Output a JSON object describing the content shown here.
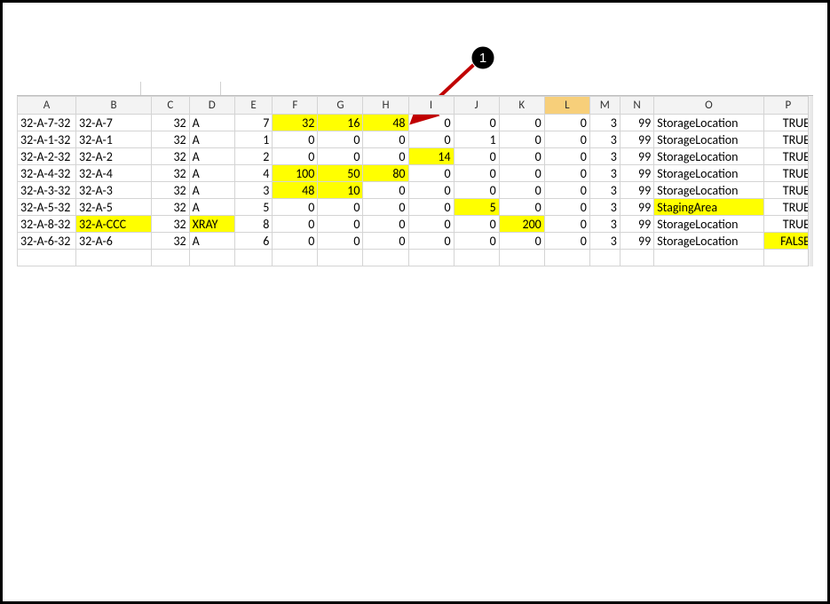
{
  "callout": {
    "number": "1"
  },
  "columns": [
    {
      "label": "A",
      "sel": false
    },
    {
      "label": "B",
      "sel": false
    },
    {
      "label": "C",
      "sel": false
    },
    {
      "label": "D",
      "sel": false
    },
    {
      "label": "E",
      "sel": false
    },
    {
      "label": "F",
      "sel": false
    },
    {
      "label": "G",
      "sel": false
    },
    {
      "label": "H",
      "sel": false
    },
    {
      "label": "I",
      "sel": false
    },
    {
      "label": "J",
      "sel": false
    },
    {
      "label": "K",
      "sel": false
    },
    {
      "label": "L",
      "sel": true
    },
    {
      "label": "M",
      "sel": false
    },
    {
      "label": "N",
      "sel": false
    },
    {
      "label": "O",
      "sel": false
    },
    {
      "label": "P",
      "sel": false
    }
  ],
  "col_align": [
    "txt",
    "txt",
    "num",
    "txt",
    "num",
    "num",
    "num",
    "num",
    "num",
    "num",
    "num",
    "num",
    "num",
    "num",
    "txt",
    "num"
  ],
  "rows": [
    {
      "cells": [
        {
          "v": "32-A-7-32"
        },
        {
          "v": "32-A-7"
        },
        {
          "v": "32"
        },
        {
          "v": "A"
        },
        {
          "v": "7"
        },
        {
          "v": "32",
          "hl": true
        },
        {
          "v": "16",
          "hl": true
        },
        {
          "v": "48",
          "hl": true
        },
        {
          "v": "0"
        },
        {
          "v": "0"
        },
        {
          "v": "0"
        },
        {
          "v": "0"
        },
        {
          "v": "3"
        },
        {
          "v": "99"
        },
        {
          "v": "StorageLocation"
        },
        {
          "v": "TRUE"
        }
      ]
    },
    {
      "cells": [
        {
          "v": "32-A-1-32"
        },
        {
          "v": "32-A-1"
        },
        {
          "v": "32"
        },
        {
          "v": "A"
        },
        {
          "v": "1"
        },
        {
          "v": "0"
        },
        {
          "v": "0"
        },
        {
          "v": "0"
        },
        {
          "v": "0"
        },
        {
          "v": "1"
        },
        {
          "v": "0"
        },
        {
          "v": "0"
        },
        {
          "v": "3"
        },
        {
          "v": "99"
        },
        {
          "v": "StorageLocation"
        },
        {
          "v": "TRUE"
        }
      ]
    },
    {
      "cells": [
        {
          "v": "32-A-2-32"
        },
        {
          "v": "32-A-2"
        },
        {
          "v": "32"
        },
        {
          "v": "A"
        },
        {
          "v": "2"
        },
        {
          "v": "0"
        },
        {
          "v": "0"
        },
        {
          "v": "0"
        },
        {
          "v": "14",
          "hl": true
        },
        {
          "v": "0"
        },
        {
          "v": "0"
        },
        {
          "v": "0"
        },
        {
          "v": "3"
        },
        {
          "v": "99"
        },
        {
          "v": "StorageLocation"
        },
        {
          "v": "TRUE"
        }
      ]
    },
    {
      "cells": [
        {
          "v": "32-A-4-32"
        },
        {
          "v": "32-A-4"
        },
        {
          "v": "32"
        },
        {
          "v": "A"
        },
        {
          "v": "4"
        },
        {
          "v": "100",
          "hl": true
        },
        {
          "v": "50",
          "hl": true
        },
        {
          "v": "80",
          "hl": true
        },
        {
          "v": "0"
        },
        {
          "v": "0"
        },
        {
          "v": "0"
        },
        {
          "v": "0"
        },
        {
          "v": "3"
        },
        {
          "v": "99"
        },
        {
          "v": "StorageLocation"
        },
        {
          "v": "TRUE"
        }
      ]
    },
    {
      "cells": [
        {
          "v": "32-A-3-32"
        },
        {
          "v": "32-A-3"
        },
        {
          "v": "32"
        },
        {
          "v": "A"
        },
        {
          "v": "3"
        },
        {
          "v": "48",
          "hl": true
        },
        {
          "v": "10",
          "hl": true
        },
        {
          "v": "0"
        },
        {
          "v": "0"
        },
        {
          "v": "0"
        },
        {
          "v": "0"
        },
        {
          "v": "0"
        },
        {
          "v": "3"
        },
        {
          "v": "99"
        },
        {
          "v": "StorageLocation"
        },
        {
          "v": "TRUE"
        }
      ]
    },
    {
      "cells": [
        {
          "v": "32-A-5-32"
        },
        {
          "v": "32-A-5"
        },
        {
          "v": "32"
        },
        {
          "v": "A"
        },
        {
          "v": "5"
        },
        {
          "v": "0"
        },
        {
          "v": "0"
        },
        {
          "v": "0"
        },
        {
          "v": "0"
        },
        {
          "v": "5",
          "hl": true
        },
        {
          "v": "0"
        },
        {
          "v": "0"
        },
        {
          "v": "3"
        },
        {
          "v": "99"
        },
        {
          "v": "StagingArea",
          "hl": true
        },
        {
          "v": "TRUE"
        }
      ]
    },
    {
      "cells": [
        {
          "v": "32-A-8-32"
        },
        {
          "v": "32-A-CCC",
          "hl": true
        },
        {
          "v": "32"
        },
        {
          "v": "XRAY",
          "hl": true
        },
        {
          "v": "8"
        },
        {
          "v": "0"
        },
        {
          "v": "0"
        },
        {
          "v": "0"
        },
        {
          "v": "0"
        },
        {
          "v": "0"
        },
        {
          "v": "200",
          "hl": true
        },
        {
          "v": "0"
        },
        {
          "v": "3"
        },
        {
          "v": "99"
        },
        {
          "v": "StorageLocation"
        },
        {
          "v": "TRUE"
        }
      ]
    },
    {
      "cells": [
        {
          "v": "32-A-6-32"
        },
        {
          "v": "32-A-6"
        },
        {
          "v": "32"
        },
        {
          "v": "A"
        },
        {
          "v": "6"
        },
        {
          "v": "0"
        },
        {
          "v": "0"
        },
        {
          "v": "0"
        },
        {
          "v": "0"
        },
        {
          "v": "0"
        },
        {
          "v": "0"
        },
        {
          "v": "0"
        },
        {
          "v": "3"
        },
        {
          "v": "99"
        },
        {
          "v": "StorageLocation"
        },
        {
          "v": "FALSE",
          "hl": true
        }
      ]
    }
  ],
  "chart_data": {
    "type": "table",
    "headers": [
      "A",
      "B",
      "C",
      "D",
      "E",
      "F",
      "G",
      "H",
      "I",
      "J",
      "K",
      "L",
      "M",
      "N",
      "O",
      "P"
    ],
    "rows": [
      [
        "32-A-7-32",
        "32-A-7",
        32,
        "A",
        7,
        32,
        16,
        48,
        0,
        0,
        0,
        0,
        3,
        99,
        "StorageLocation",
        "TRUE"
      ],
      [
        "32-A-1-32",
        "32-A-1",
        32,
        "A",
        1,
        0,
        0,
        0,
        0,
        1,
        0,
        0,
        3,
        99,
        "StorageLocation",
        "TRUE"
      ],
      [
        "32-A-2-32",
        "32-A-2",
        32,
        "A",
        2,
        0,
        0,
        0,
        14,
        0,
        0,
        0,
        3,
        99,
        "StorageLocation",
        "TRUE"
      ],
      [
        "32-A-4-32",
        "32-A-4",
        32,
        "A",
        4,
        100,
        50,
        80,
        0,
        0,
        0,
        0,
        3,
        99,
        "StorageLocation",
        "TRUE"
      ],
      [
        "32-A-3-32",
        "32-A-3",
        32,
        "A",
        3,
        48,
        10,
        0,
        0,
        0,
        0,
        0,
        3,
        99,
        "StorageLocation",
        "TRUE"
      ],
      [
        "32-A-5-32",
        "32-A-5",
        32,
        "A",
        5,
        0,
        0,
        0,
        0,
        5,
        0,
        0,
        3,
        99,
        "StagingArea",
        "TRUE"
      ],
      [
        "32-A-8-32",
        "32-A-CCC",
        32,
        "XRAY",
        8,
        0,
        0,
        0,
        0,
        0,
        200,
        0,
        3,
        99,
        "StorageLocation",
        "TRUE"
      ],
      [
        "32-A-6-32",
        "32-A-6",
        32,
        "A",
        6,
        0,
        0,
        0,
        0,
        0,
        0,
        0,
        3,
        99,
        "StorageLocation",
        "FALSE"
      ]
    ],
    "highlighted_cells_rowcol_1based": [
      [
        1,
        6
      ],
      [
        1,
        7
      ],
      [
        1,
        8
      ],
      [
        3,
        9
      ],
      [
        4,
        6
      ],
      [
        4,
        7
      ],
      [
        4,
        8
      ],
      [
        5,
        6
      ],
      [
        5,
        7
      ],
      [
        6,
        10
      ],
      [
        6,
        15
      ],
      [
        7,
        2
      ],
      [
        7,
        4
      ],
      [
        7,
        11
      ],
      [
        8,
        16
      ]
    ],
    "selected_column": "L"
  }
}
